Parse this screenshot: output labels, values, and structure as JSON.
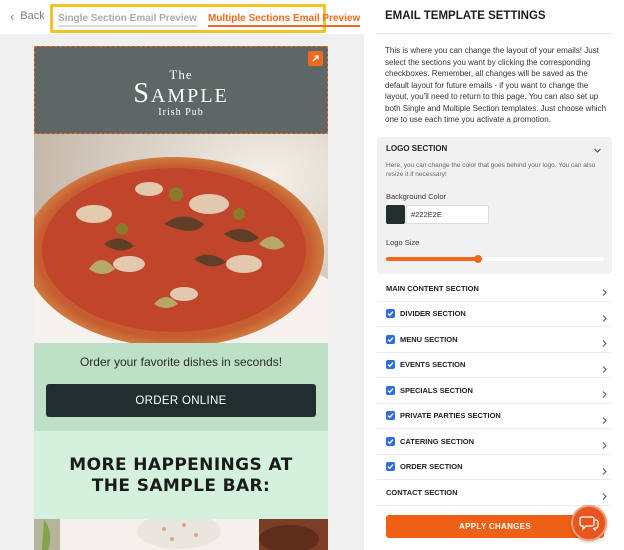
{
  "nav": {
    "back_label": "Back",
    "tabs": [
      {
        "label": "Single Section Email Preview",
        "active": false
      },
      {
        "label": "Multiple Sections Email Preview",
        "active": true
      }
    ]
  },
  "preview": {
    "logo": {
      "line1": "The",
      "line2": "Sample",
      "line3": "Irish Pub"
    },
    "cta_text": "Order your favorite dishes in seconds!",
    "cta_button": "ORDER ONLINE",
    "happenings_title": "MORE HAPPENINGS AT THE SAMPLE BAR:"
  },
  "settings": {
    "title": "EMAIL TEMPLATE SETTINGS",
    "intro": "This is where you can change the layout of your emails! Just select the sections you want by clicking the corresponding checkboxes. Remember, all changes will be saved as the default layout for future emails - if you want to change the layout, you'll need to return to this page. You can also set up both Single and Multiple Section templates. Just choose which one to use each time you activate a promotion.",
    "logo_section": {
      "title": "LOGO SECTION",
      "description": "Here, you can change the color that goes behind your logo. You can also resize it if necessary!",
      "bg_label": "Background Color",
      "bg_color": "#222E2E",
      "size_label": "Logo Size",
      "size_fraction": 0.42
    },
    "sections": [
      {
        "label": "MAIN CONTENT SECTION",
        "checkbox": false
      },
      {
        "label": "DIVIDER SECTION",
        "checkbox": true,
        "checked": true
      },
      {
        "label": "MENU SECTION",
        "checkbox": true,
        "checked": true
      },
      {
        "label": "EVENTS SECTION",
        "checkbox": true,
        "checked": true
      },
      {
        "label": "SPECIALS SECTION",
        "checkbox": true,
        "checked": true
      },
      {
        "label": "PRIVATE PARTIES SECTION",
        "checkbox": true,
        "checked": true
      },
      {
        "label": "CATERING SECTION",
        "checkbox": true,
        "checked": true
      },
      {
        "label": "ORDER SECTION",
        "checkbox": true,
        "checked": true
      },
      {
        "label": "CONTACT SECTION",
        "checkbox": false
      }
    ],
    "apply_label": "APPLY CHANGES"
  },
  "colors": {
    "accent": "#EF6A1C",
    "checkbox": "#2F6EE0",
    "logo_bg": "#5F6766",
    "button_dark": "#222E2E",
    "cta_bg": "#BDE0C6",
    "happenings_bg": "#D4F1DE",
    "tab_highlight": "#F3C42A"
  },
  "icons": [
    "chevron-left-icon",
    "expand-arrow-icon",
    "chevron-down-icon",
    "chevron-right-icon",
    "checkmark-icon",
    "chat-icon"
  ]
}
